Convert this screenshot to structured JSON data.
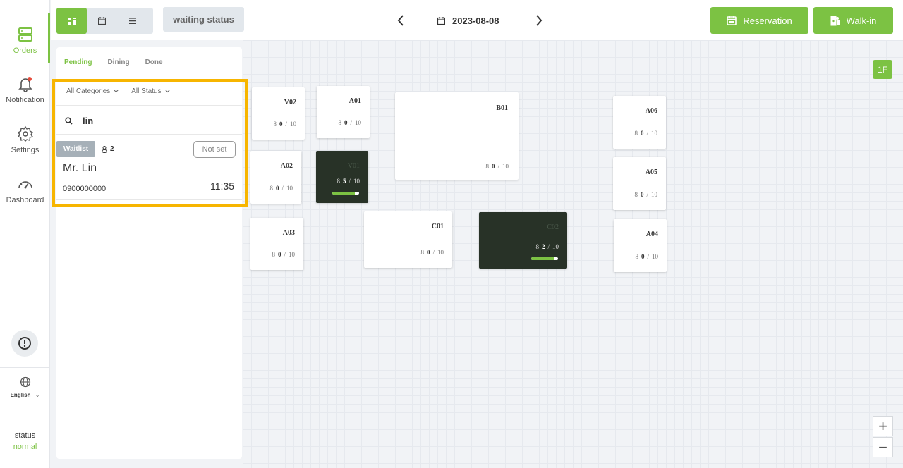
{
  "nav": {
    "items": [
      {
        "label": "Orders",
        "icon": "orders-icon",
        "active": true
      },
      {
        "label": "Notification",
        "icon": "bell-icon"
      },
      {
        "label": "Settings",
        "icon": "gear-icon"
      },
      {
        "label": "Dashboard",
        "icon": "gauge-icon"
      }
    ],
    "language": "English",
    "status_label": "status",
    "status_value": "normal"
  },
  "topbar": {
    "waiting_status_label": "waiting status",
    "date": "2023-08-08",
    "reservation_label": "Reservation",
    "walkin_label": "Walk-in"
  },
  "panel": {
    "tabs": [
      "Pending",
      "Dining",
      "Done"
    ],
    "active_tab": "Pending",
    "category_filter": "All Categories",
    "status_filter": "All Status",
    "search_value": "lin",
    "card": {
      "badge": "Waitlist",
      "party_size": "2",
      "table_button": "Not set",
      "name": "Mr. Lin",
      "phone": "0900000000",
      "time": "11:35"
    }
  },
  "floor": {
    "label": "1F",
    "zoom_in": "+",
    "zoom_out": "−",
    "tables": [
      {
        "name": "V02",
        "seated": "0",
        "capacity": "10",
        "occupied": false
      },
      {
        "name": "A01",
        "seated": "0",
        "capacity": "10",
        "occupied": false
      },
      {
        "name": "B01",
        "seated": "0",
        "capacity": "10",
        "occupied": false
      },
      {
        "name": "A06",
        "seated": "0",
        "capacity": "10",
        "occupied": false
      },
      {
        "name": "A02",
        "seated": "0",
        "capacity": "10",
        "occupied": false
      },
      {
        "name": "V01",
        "seated": "5",
        "capacity": "10",
        "occupied": true,
        "progress": 0.85
      },
      {
        "name": "A05",
        "seated": "0",
        "capacity": "10",
        "occupied": false
      },
      {
        "name": "A03",
        "seated": "0",
        "capacity": "10",
        "occupied": false
      },
      {
        "name": "C01",
        "seated": "0",
        "capacity": "10",
        "occupied": false
      },
      {
        "name": "C02",
        "seated": "2",
        "capacity": "10",
        "occupied": true,
        "progress": 0.85
      },
      {
        "name": "A04",
        "seated": "0",
        "capacity": "10",
        "occupied": false
      }
    ]
  },
  "colors": {
    "accent": "#7cc243",
    "highlight": "#f7b500",
    "table_dark": "#283227"
  }
}
